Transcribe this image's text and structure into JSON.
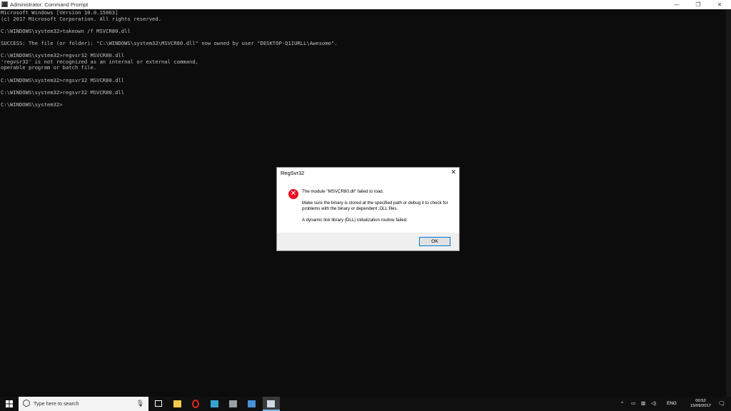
{
  "window": {
    "title": "Administrator: Command Prompt",
    "icon": "cmd-icon",
    "minimize": "—",
    "maximize": "❐",
    "close": "✕"
  },
  "console": {
    "lines": [
      "Microsoft Windows [Version 10.0.15063]",
      "(c) 2017 Microsoft Corporation. All rights reserved.",
      "",
      "C:\\WINDOWS\\system32>takeown /f MSVCR80.dll",
      "",
      "SUCCESS: The file (or folder): \"C:\\WINDOWS\\system32\\MSVCR80.dll\" now owned by user \"DESKTOP-Q1IURLL\\Awesome\".",
      "",
      "C:\\WINDOWS\\system32>regvsr32 MSVCR80.dll",
      "'regvsr32' is not recognized as an internal or external command,",
      "operable program or batch file.",
      "",
      "C:\\WINDOWS\\system32>regsvr32 MSVCR80.dll",
      "",
      "C:\\WINDOWS\\system32>regsvr32 MSVCR80.dll",
      "",
      "C:\\WINDOWS\\system32>"
    ]
  },
  "dialog": {
    "title": "RegSvr32",
    "close": "✕",
    "icon": "error-icon",
    "icon_glyph": "✕",
    "message_1": "The module \"MSVCR80.dll\" failed to load.",
    "message_2": "Make sure the binary is stored at the specified path or debug it to check for problems with the binary or dependent .DLL files.",
    "message_3": "A dynamic link library (DLL) initialization routine failed.",
    "ok_label": "OK"
  },
  "taskbar": {
    "search_placeholder": "Type here to search",
    "mic_glyph": "🎙",
    "pinned": [
      {
        "name": "task-view-icon",
        "color": "#ffffff"
      },
      {
        "name": "file-explorer-icon",
        "color": "#f2c94c"
      },
      {
        "name": "opera-icon",
        "color": "#e0261b"
      },
      {
        "name": "maxthon-icon",
        "color": "#38a3d1"
      },
      {
        "name": "terminal-icon",
        "color": "#9aa0a6"
      },
      {
        "name": "network-app-icon",
        "color": "#4a90d9"
      },
      {
        "name": "command-prompt-icon",
        "color": "#cfd8e3"
      }
    ],
    "tray": {
      "chevron": "^",
      "language": "ENG",
      "time": "00:52",
      "date": "15/09/2017",
      "notification_glyph": "🗨"
    }
  }
}
